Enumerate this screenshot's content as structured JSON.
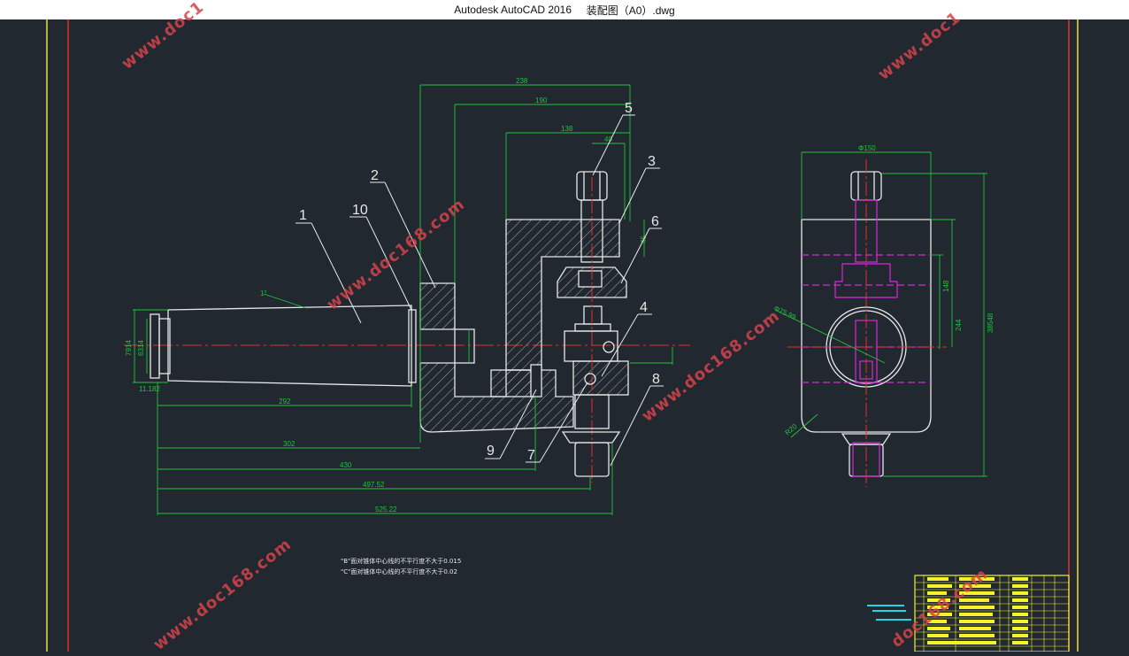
{
  "window": {
    "app_title": "Autodesk AutoCAD 2016",
    "file_title": "装配图（A0）.dwg"
  },
  "colors": {
    "background": "#212830",
    "border_yellow": "#e8e33a",
    "border_red": "#e0322f",
    "outline": "#e8e8e8",
    "dimension": "#22c43a",
    "centerline": "#e0322f",
    "hidden": "#d62ad6",
    "watermark": "#d8434a",
    "title_block": "#f3f129",
    "leader_cyan": "#22d8e8"
  },
  "drawing": {
    "dimensions": {
      "d238": "238",
      "d190": "190",
      "d138": "138",
      "d40": "40",
      "d45": "45",
      "d292": "292",
      "d302": "302",
      "d430": "430",
      "d49752": "497.52",
      "d52522": "525.22",
      "d7914": "7914",
      "d6314": "6314",
      "d11182": "11.182",
      "taper": "1°",
      "d150": "Φ150",
      "d148": "148",
      "d244": "244",
      "d38548": "38548",
      "d7599": "Φ75.99",
      "r20": "R20"
    },
    "part_labels": [
      "1",
      "10",
      "2",
      "5",
      "3",
      "6",
      "4",
      "8",
      "9",
      "7"
    ],
    "notes": [
      "\"B\"面对锥体中心线的不平行度不大于0.015",
      "\"C\"面对锥体中心线的不平行度不大于0.02"
    ]
  },
  "watermarks": {
    "text_long": "www.doc168.com",
    "text_partial_1": "www.doc1",
    "text_partial_2": "www.doc1",
    "text_partial_3": "doc168.com"
  }
}
